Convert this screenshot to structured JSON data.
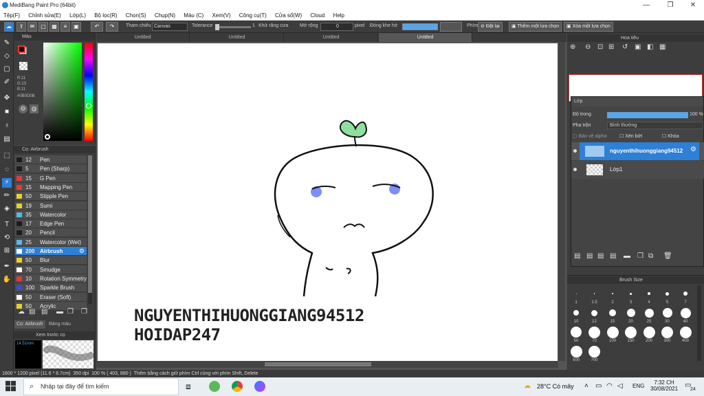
{
  "window": {
    "title": "MediBang Paint Pro (64bit)",
    "minimize": "—",
    "maximize": "❐",
    "close": "✕"
  },
  "menu": [
    "Tệp(F)",
    "Chỉnh sửa(E)",
    "Lớp(L)",
    "Bộ lọc(R)",
    "Chọn(S)",
    "Chụp(N)",
    "Màu (C)",
    "Xem(V)",
    "Công cụ(T)",
    "Cửa sổ(W)",
    "Cloud",
    "Help"
  ],
  "toolbar": {
    "tham_chieu_label": "Tham chiếu",
    "tham_chieu_value": "Canvas",
    "tolerance_label": "Tolerance",
    "tolerance_value": "1",
    "khu_rang_cua": "Khử răng cưa",
    "mo_rong_label": "Mở rộng",
    "mo_rong_value": "0",
    "mo_rong_unit": "pixel",
    "dong_kho_ho": "Đóng khe hở",
    "phim_label": "Phím",
    "dat_lai": "Đặt lại",
    "them_lua_chon": "Thêm một lựa chọn",
    "xoa_lua_chon": "Xóa một lựa chọn"
  },
  "tabs": [
    "Untitled",
    "Untitled",
    "Untitled",
    "Untitled"
  ],
  "color_panel": {
    "title": "Màu",
    "rgb_r": "R:11",
    "rgb_g": "G:13",
    "rgb_b": "B:11",
    "hex": "#0B0D0B",
    "primary_color": "#0b0d0b",
    "secondary_color": "#ffffff"
  },
  "brush_panel": {
    "title": "Cọ: Airbrush",
    "brushes": [
      {
        "size": "12",
        "name": "Pen",
        "color": "#1c1c1c"
      },
      {
        "size": "5",
        "name": "Pen (Sharp)",
        "color": "#1c1c1c"
      },
      {
        "size": "15",
        "name": "G Pen",
        "color": "#e23a3a"
      },
      {
        "size": "15",
        "name": "Mapping Pen",
        "color": "#e23a3a"
      },
      {
        "size": "50",
        "name": "Stipple Pen",
        "color": "#e6d12c"
      },
      {
        "size": "19",
        "name": "Sumi",
        "color": "#e6d12c"
      },
      {
        "size": "35",
        "name": "Watercolor",
        "color": "#55b8e8"
      },
      {
        "size": "17",
        "name": "Edge Pen",
        "color": "#1c1c1c"
      },
      {
        "size": "20",
        "name": "Pencil",
        "color": "#1c1c1c"
      },
      {
        "size": "25",
        "name": "Watercolor (Wet)",
        "color": "#55b8e8"
      },
      {
        "size": "200",
        "name": "Airbrush",
        "color": "#ffffff"
      },
      {
        "size": "50",
        "name": "Blur",
        "color": "#e6d12c"
      },
      {
        "size": "70",
        "name": "Smudge",
        "color": "#ffffff"
      },
      {
        "size": "10",
        "name": "Rotation Symmetry",
        "color": "#e23a3a"
      },
      {
        "size": "100",
        "name": "Sparkle Brush",
        "color": "#2f4ee0"
      },
      {
        "size": "50",
        "name": "Eraser (Soft)",
        "color": "#ffffff"
      },
      {
        "size": "50",
        "name": "Acrylic",
        "color": "#e6d12c"
      }
    ],
    "active_index": 10,
    "tab1": "Cọ: Airbrush",
    "tab2": "Bảng màu"
  },
  "preview_panel": {
    "title": "Xem trước cọ",
    "size": "14.51mm"
  },
  "canvas": {
    "text_line1": "NGUYENTHIHUONGGIANG94512",
    "text_line2": "HOIDAP247"
  },
  "navigator": {
    "title": "Hoa tiêu"
  },
  "layer_panel": {
    "title": "Lớp",
    "opacity_label": "Độ trong",
    "opacity_value": "100 %",
    "opacity": 1.0,
    "blend_label": "Pha trộn",
    "blend_value": "Bình thường",
    "bao_ve_alpha": "Bảo vệ alpha",
    "xen_bot": "Xén bớt",
    "khoa": "Khóa",
    "layers": [
      {
        "name": "nguyenthihuonggiang94512",
        "active": true
      },
      {
        "name": "Lớp1",
        "active": false
      }
    ]
  },
  "brush_size_panel": {
    "title": "Brush Size",
    "sizes": [
      "1",
      "1.5",
      "2",
      "3",
      "4",
      "5",
      "7",
      "10",
      "12",
      "15",
      "20",
      "25",
      "30",
      "40",
      "50",
      "70",
      "100",
      "150",
      "200",
      "300",
      "400",
      "500",
      "700"
    ]
  },
  "status": {
    "dimensions": "1600 * 1200 pixel",
    "cm": "(11.6 * 8.7cm)",
    "dpi": "350 dpi",
    "zoom": "100 %",
    "coords": "( 403, 880 )",
    "hint": "Thêm bằng cách giữ phím Ctrl cùng với phím Shift, Delete"
  },
  "taskbar": {
    "search_placeholder": "Nhập tại đây để tìm kiếm",
    "weather": "28°C Có mây",
    "lang": "ENG",
    "time": "7:32 CH",
    "date": "30/08/2021",
    "notif": "24"
  }
}
